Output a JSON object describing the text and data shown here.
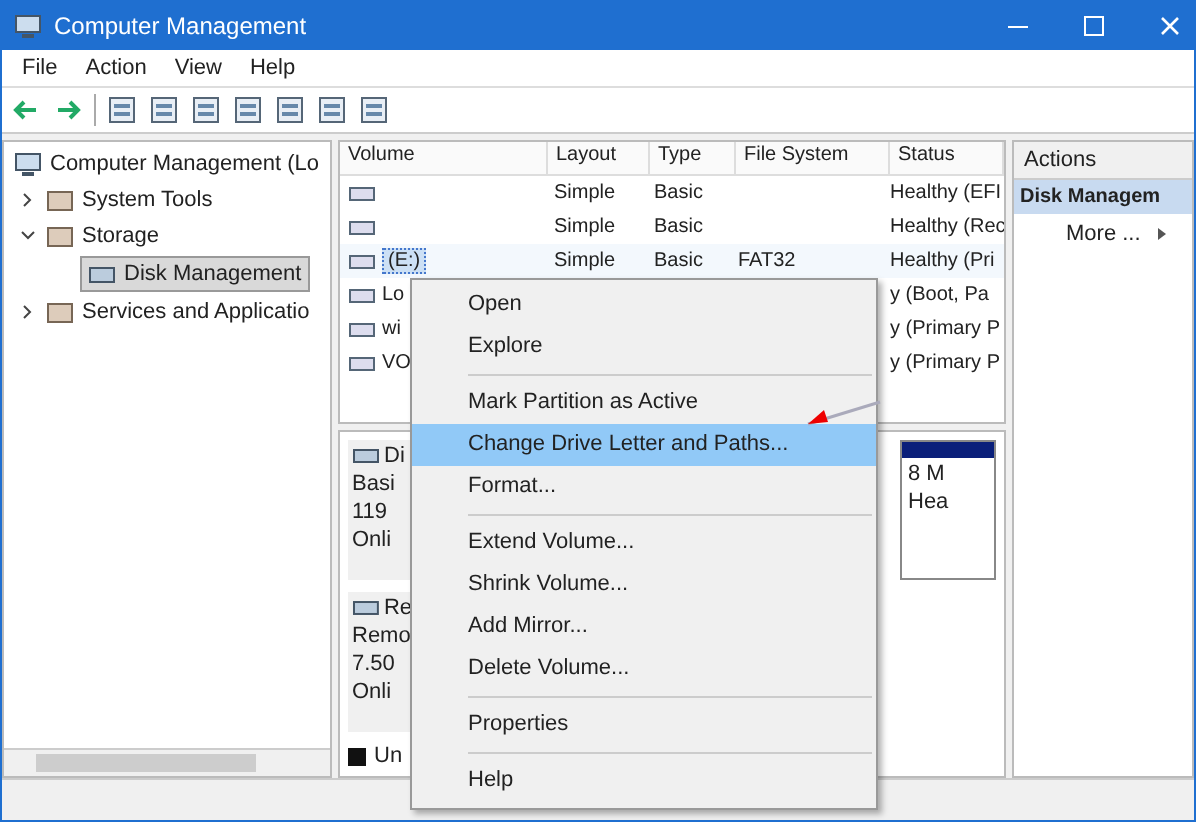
{
  "window": {
    "title": "Computer Management"
  },
  "menu": [
    "File",
    "Action",
    "View",
    "Help"
  ],
  "tree": [
    {
      "label": "Computer Management (Lo",
      "selected": false,
      "children": [
        {
          "label": "System Tools",
          "expanded": false,
          "selected": false
        },
        {
          "label": "Storage",
          "expanded": true,
          "selected": false,
          "children": [
            {
              "label": "Disk Management",
              "selected": true
            }
          ]
        },
        {
          "label": "Services and Applicatio",
          "expanded": false,
          "selected": false
        }
      ]
    }
  ],
  "table": {
    "columns": [
      "Volume",
      "Layout",
      "Type",
      "File System",
      "Status"
    ],
    "rows": [
      {
        "volume": "",
        "layout": "Simple",
        "type": "Basic",
        "fs": "",
        "status": "Healthy (EFI",
        "selected": false
      },
      {
        "volume": "",
        "layout": "Simple",
        "type": "Basic",
        "fs": "",
        "status": "Healthy (Rec",
        "selected": false
      },
      {
        "volume": "(E:)",
        "layout": "Simple",
        "type": "Basic",
        "fs": "FAT32",
        "status": "Healthy (Pri",
        "selected": true
      },
      {
        "volume": "Lo",
        "layout": "",
        "type": "",
        "fs": "",
        "status": "y (Boot, Pa",
        "selected": false
      },
      {
        "volume": "wi",
        "layout": "",
        "type": "",
        "fs": "",
        "status": "y (Primary P",
        "selected": false
      },
      {
        "volume": "VO",
        "layout": "",
        "type": "",
        "fs": "",
        "status": "y (Primary P",
        "selected": false
      }
    ]
  },
  "disks": [
    {
      "label": "Di",
      "lines": [
        "Basi",
        "119",
        "Onli"
      ]
    },
    {
      "label": "Re",
      "lines": [
        "Remo",
        "7.50",
        "Onli"
      ]
    }
  ],
  "legend": "Un",
  "partition": {
    "lines": [
      "8 M",
      "Hea"
    ]
  },
  "context_menu": [
    {
      "kind": "item",
      "label": "Open",
      "selected": false
    },
    {
      "kind": "item",
      "label": "Explore",
      "selected": false
    },
    {
      "kind": "separator"
    },
    {
      "kind": "item",
      "label": "Mark Partition as Active",
      "selected": false
    },
    {
      "kind": "item",
      "label": "Change Drive Letter and Paths...",
      "selected": true
    },
    {
      "kind": "item",
      "label": "Format...",
      "selected": false
    },
    {
      "kind": "separator"
    },
    {
      "kind": "item",
      "label": "Extend Volume...",
      "selected": false
    },
    {
      "kind": "item",
      "label": "Shrink Volume...",
      "selected": false
    },
    {
      "kind": "item",
      "label": "Add Mirror...",
      "selected": false
    },
    {
      "kind": "item",
      "label": "Delete Volume...",
      "selected": false
    },
    {
      "kind": "separator"
    },
    {
      "kind": "item",
      "label": "Properties",
      "selected": false
    },
    {
      "kind": "separator"
    },
    {
      "kind": "item",
      "label": "Help",
      "selected": false
    }
  ],
  "actions": {
    "title": "Actions",
    "section": "Disk Managem",
    "items": [
      "More ..."
    ]
  }
}
